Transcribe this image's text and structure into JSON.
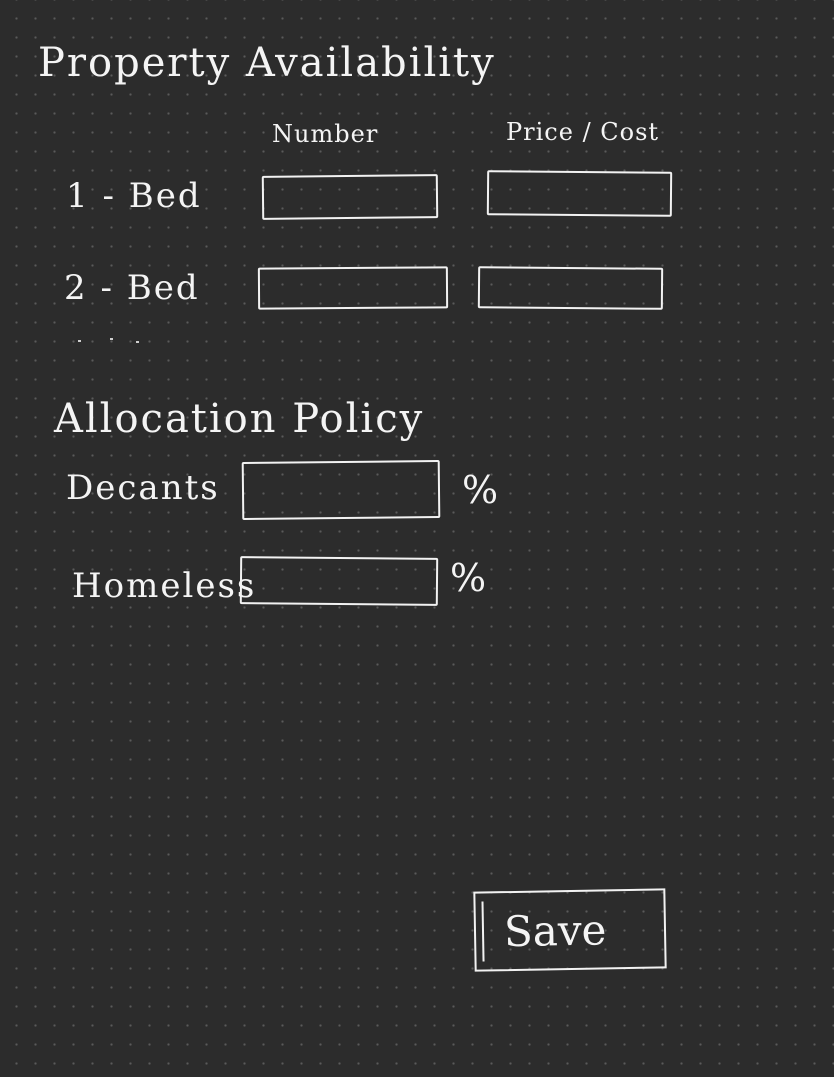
{
  "property_availability": {
    "title": "Property Availability",
    "columns": {
      "number": "Number",
      "price": "Price / Cost"
    },
    "rows": [
      {
        "label": "1 - Bed",
        "number_value": "",
        "price_value": ""
      },
      {
        "label": "2 - Bed",
        "number_value": "",
        "price_value": ""
      }
    ]
  },
  "allocation_policy": {
    "title": "Allocation Policy",
    "fields": [
      {
        "label": "Decants",
        "value": "",
        "unit": "%"
      },
      {
        "label": "Homeless",
        "value": "",
        "unit": "%"
      }
    ]
  },
  "actions": {
    "save_label": "Save"
  },
  "colors": {
    "background": "#2c2c2c",
    "grid_dot": "#5a5a5a",
    "ink": "#f2f2f2"
  }
}
